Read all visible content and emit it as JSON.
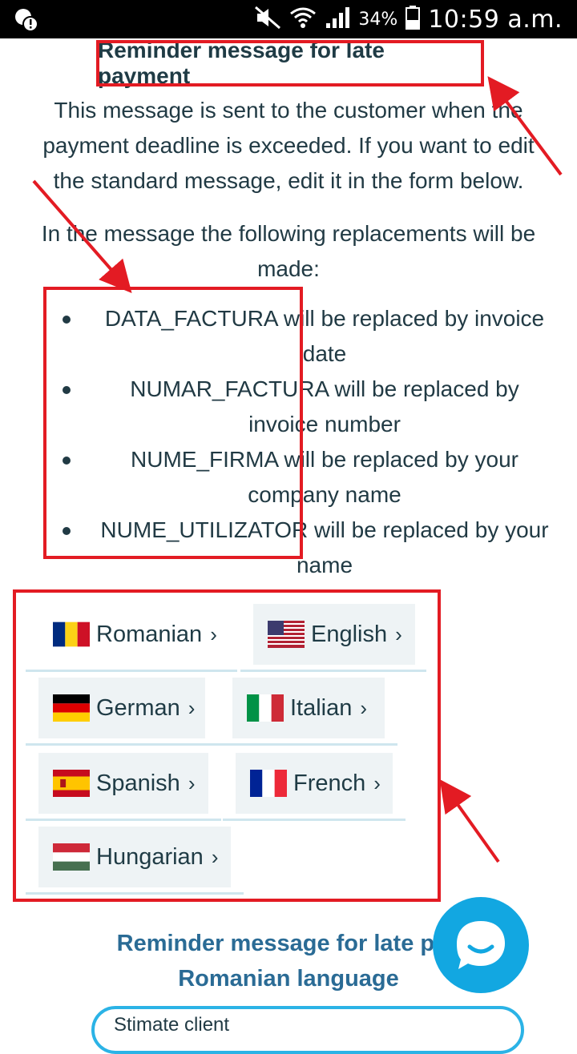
{
  "status_bar": {
    "battery_percent": "34%",
    "time": "10:59 a.m."
  },
  "page": {
    "title": "Reminder message for late payment",
    "description": "This message is sent to the customer when the payment deadline is exceeded. If you want to edit the standard message, edit it in the form below.",
    "replacements_intro": "In the message the following replacements will be made:",
    "replacements": [
      "DATA_FACTURA will be replaced by invoice date",
      "NUMAR_FACTURA will be replaced by invoice number",
      "NUME_FIRMA will be replaced by your company name",
      "NUME_UTILIZATOR will be replaced by your name"
    ]
  },
  "languages": [
    {
      "label": "Romanian",
      "flag": "romania-flag"
    },
    {
      "label": "English",
      "flag": "usa-flag"
    },
    {
      "label": "German",
      "flag": "germany-flag"
    },
    {
      "label": "Italian",
      "flag": "italy-flag"
    },
    {
      "label": "Spanish",
      "flag": "spain-flag"
    },
    {
      "label": "French",
      "flag": "france-flag"
    },
    {
      "label": "Hungarian",
      "flag": "hungary-flag"
    }
  ],
  "chevron": "›",
  "section": {
    "title_line1": "Reminder message for late pay",
    "title_line2": "Romanian language",
    "textarea_value": "Stimate client"
  },
  "colors": {
    "annotation_red": "#e31b23",
    "accent_blue": "#12a7e1",
    "heading_blue": "#2a6b95"
  }
}
